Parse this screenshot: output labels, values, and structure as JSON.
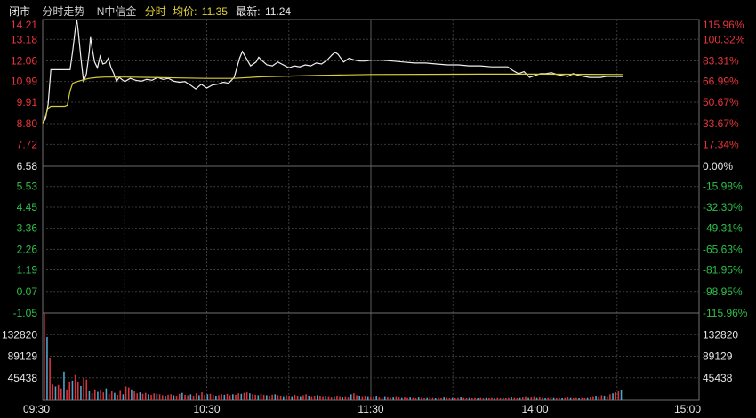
{
  "header": {
    "market_status": "闭市",
    "view_mode": "分时走势",
    "stock_name": "N中信金",
    "intraday_label": "分时",
    "avg_label": "均价:",
    "avg_value": "11.35",
    "latest_label": "最新:",
    "latest_value": "11.24"
  },
  "colors": {
    "up": "#e8343c",
    "down": "#2dbf4a",
    "neutral": "#e6e6e6",
    "price_line": "#f0f0f0",
    "avg_line": "#d7cc3a",
    "grid": "#3a3a3a",
    "axis": "#707070",
    "vol_up": "#d8323c",
    "vol_down": "#4fa3c8"
  },
  "chart_data": {
    "type": "line",
    "y_left_ticks": [
      "14.21",
      "13.18",
      "12.06",
      "10.99",
      "9.91",
      "8.80",
      "7.72",
      "6.58",
      "5.53",
      "4.45",
      "3.36",
      "2.26",
      "1.19",
      "0.07",
      "-1.05"
    ],
    "y_right_ticks": [
      "115.96%",
      "100.32%",
      "83.31%",
      "66.99%",
      "50.67%",
      "33.67%",
      "17.34%",
      "0.00%",
      "-15.98%",
      "-32.30%",
      "-49.31%",
      "-65.63%",
      "-81.95%",
      "-98.95%",
      "-115.96%"
    ],
    "ylim": [
      -1.05,
      14.21
    ],
    "prev_close": 6.58,
    "x_ticks": [
      "09:30",
      "10:30",
      "11:30",
      "14:00",
      "15:00"
    ],
    "x_total_minutes": 240,
    "volume_ticks": [
      "132820",
      "89129",
      "45438"
    ],
    "volume_max": 176510,
    "price_series": [
      [
        0,
        8.82
      ],
      [
        1,
        9.05
      ],
      [
        2,
        9.8
      ],
      [
        3,
        11.6
      ],
      [
        5,
        11.6
      ],
      [
        7,
        11.6
      ],
      [
        9,
        11.6
      ],
      [
        10,
        11.6
      ],
      [
        11,
        12.6
      ],
      [
        12,
        13.8
      ],
      [
        12.5,
        14.18
      ],
      [
        13,
        13.6
      ],
      [
        14,
        12.2
      ],
      [
        15,
        10.95
      ],
      [
        16,
        11.4
      ],
      [
        17,
        12.5
      ],
      [
        17.5,
        13.3
      ],
      [
        18,
        12.8
      ],
      [
        19,
        12.0
      ],
      [
        20,
        11.7
      ],
      [
        21,
        12.3
      ],
      [
        22,
        11.9
      ],
      [
        23,
        11.95
      ],
      [
        24,
        12.2
      ],
      [
        25,
        11.7
      ],
      [
        26,
        11.4
      ],
      [
        27,
        11.0
      ],
      [
        28,
        11.2
      ],
      [
        30,
        10.98
      ],
      [
        32,
        11.15
      ],
      [
        34,
        11.05
      ],
      [
        36,
        11.0
      ],
      [
        38,
        11.1
      ],
      [
        40,
        11.05
      ],
      [
        42,
        11.2
      ],
      [
        44,
        11.1
      ],
      [
        46,
        11.15
      ],
      [
        48,
        11.0
      ],
      [
        50,
        10.95
      ],
      [
        52,
        10.98
      ],
      [
        54,
        10.8
      ],
      [
        56,
        10.6
      ],
      [
        58,
        10.85
      ],
      [
        60,
        10.65
      ],
      [
        62,
        10.8
      ],
      [
        64,
        10.85
      ],
      [
        66,
        10.95
      ],
      [
        68,
        10.9
      ],
      [
        70,
        11.2
      ],
      [
        72,
        12.2
      ],
      [
        73,
        12.55
      ],
      [
        74,
        12.3
      ],
      [
        76,
        11.8
      ],
      [
        78,
        12.0
      ],
      [
        79,
        12.25
      ],
      [
        80,
        12.1
      ],
      [
        82,
        11.85
      ],
      [
        84,
        11.8
      ],
      [
        86,
        12.0
      ],
      [
        88,
        11.85
      ],
      [
        90,
        11.7
      ],
      [
        92,
        11.8
      ],
      [
        94,
        11.75
      ],
      [
        96,
        11.85
      ],
      [
        98,
        11.8
      ],
      [
        100,
        11.95
      ],
      [
        102,
        11.9
      ],
      [
        104,
        12.1
      ],
      [
        106,
        12.4
      ],
      [
        107,
        12.5
      ],
      [
        108,
        12.4
      ],
      [
        110,
        12.0
      ],
      [
        112,
        12.2
      ],
      [
        114,
        12.1
      ],
      [
        116,
        12.05
      ],
      [
        118,
        12.05
      ],
      [
        120,
        12.1
      ],
      [
        124,
        12.1
      ],
      [
        128,
        12.05
      ],
      [
        132,
        12.0
      ],
      [
        136,
        11.95
      ],
      [
        140,
        11.95
      ],
      [
        144,
        11.9
      ],
      [
        148,
        11.85
      ],
      [
        152,
        11.85
      ],
      [
        156,
        11.8
      ],
      [
        160,
        11.8
      ],
      [
        164,
        11.75
      ],
      [
        168,
        11.75
      ],
      [
        170,
        11.75
      ],
      [
        172,
        11.55
      ],
      [
        174,
        11.4
      ],
      [
        176,
        11.5
      ],
      [
        178,
        11.2
      ],
      [
        180,
        11.3
      ],
      [
        182,
        11.4
      ],
      [
        184,
        11.4
      ],
      [
        186,
        11.45
      ],
      [
        188,
        11.35
      ],
      [
        190,
        11.3
      ],
      [
        192,
        11.25
      ],
      [
        194,
        11.4
      ],
      [
        196,
        11.3
      ],
      [
        198,
        11.25
      ],
      [
        200,
        11.2
      ],
      [
        202,
        11.2
      ],
      [
        204,
        11.2
      ],
      [
        206,
        11.25
      ],
      [
        208,
        11.25
      ],
      [
        210,
        11.25
      ],
      [
        212,
        11.24
      ]
    ],
    "avg_series": [
      [
        0,
        8.82
      ],
      [
        1,
        9.2
      ],
      [
        2,
        9.6
      ],
      [
        3,
        9.7
      ],
      [
        5,
        9.7
      ],
      [
        8,
        9.7
      ],
      [
        9,
        9.75
      ],
      [
        10,
        10.5
      ],
      [
        11,
        10.9
      ],
      [
        13,
        11.0
      ],
      [
        15,
        11.08
      ],
      [
        17,
        11.15
      ],
      [
        20,
        11.2
      ],
      [
        23,
        11.22
      ],
      [
        26,
        11.22
      ],
      [
        30,
        11.22
      ],
      [
        40,
        11.2
      ],
      [
        50,
        11.17
      ],
      [
        60,
        11.15
      ],
      [
        70,
        11.15
      ],
      [
        80,
        11.23
      ],
      [
        90,
        11.27
      ],
      [
        100,
        11.3
      ],
      [
        110,
        11.33
      ],
      [
        120,
        11.35
      ],
      [
        140,
        11.36
      ],
      [
        160,
        11.37
      ],
      [
        180,
        11.37
      ],
      [
        200,
        11.36
      ],
      [
        212,
        11.35
      ]
    ],
    "volume_series": [
      176510,
      128000,
      85000,
      32000,
      28000,
      31000,
      24000,
      58000,
      22000,
      38000,
      40000,
      51000,
      38000,
      29000,
      45000,
      42000,
      18000,
      14000,
      22000,
      17000,
      20000,
      16000,
      24000,
      13000,
      18000,
      15000,
      11000,
      19000,
      12000,
      28000,
      26000,
      22000,
      18000,
      14000,
      16000,
      13000,
      15000,
      12000,
      11000,
      14000,
      13000,
      12000,
      10000,
      9000,
      11000,
      12000,
      10000,
      9000,
      13000,
      15000,
      11000,
      10000,
      12000,
      9000,
      14000,
      10000,
      16000,
      11000,
      12000,
      13000,
      11000,
      9000,
      10000,
      12000,
      11000,
      13000,
      10000,
      12000,
      11000,
      14000,
      13000,
      15000,
      16000,
      14000,
      12000,
      11000,
      10000,
      13000,
      11000,
      10000,
      9000,
      11000,
      12000,
      10000,
      9000,
      8000,
      10000,
      9000,
      8000,
      11000,
      9000,
      8000,
      10000,
      12000,
      9000,
      8000,
      9000,
      10000,
      9000,
      8000,
      9000,
      8000,
      7000,
      8000,
      9000,
      8000,
      7000,
      8000,
      7000,
      12000,
      14000,
      10000,
      9000,
      8000,
      9000,
      8000,
      7000,
      8000,
      9000,
      7000,
      6000,
      8000,
      7000,
      6000,
      7000,
      8000,
      7000,
      6000,
      7000,
      6000,
      7000,
      6000,
      5000,
      7000,
      6000,
      5000,
      6000,
      7000,
      6000,
      5000,
      6000,
      5000,
      7000,
      6000,
      5000,
      6000,
      5000,
      6000,
      7000,
      6000,
      5000,
      6000,
      5000,
      6000,
      5000,
      6000,
      5000,
      6000,
      5000,
      6000,
      5000,
      6000,
      5000,
      6000,
      5000,
      6000,
      7000,
      6000,
      5000,
      6000,
      7000,
      8000,
      6000,
      7000,
      8000,
      6000,
      7000,
      6000,
      5000,
      6000,
      7000,
      6000,
      5000,
      6000,
      5000,
      6000,
      7000,
      6000,
      5000,
      6000,
      5000,
      6000,
      5000,
      6000,
      7000,
      8000,
      9000,
      8000,
      10000,
      9000,
      8000,
      12000,
      14000,
      16000,
      18000,
      20000
    ]
  }
}
